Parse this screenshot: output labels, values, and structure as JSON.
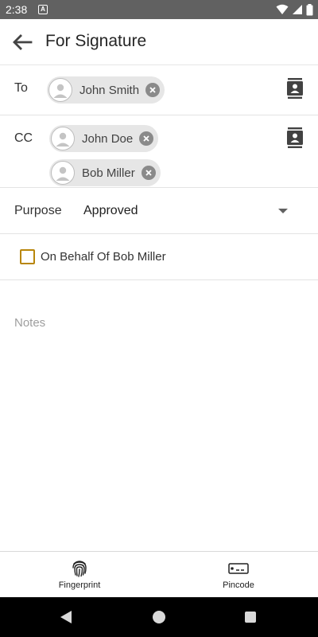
{
  "status_bar": {
    "time": "2:38",
    "notification_glyph": "A"
  },
  "header": {
    "title": "For Signature",
    "back_icon": "arrow-left-icon"
  },
  "to": {
    "label": "To",
    "recipients": [
      {
        "name": "John Smith"
      }
    ],
    "contacts_icon": "contacts-book-icon"
  },
  "cc": {
    "label": "CC",
    "recipients": [
      {
        "name": "John Doe"
      },
      {
        "name": "Bob Miller"
      }
    ],
    "contacts_icon": "contacts-book-icon"
  },
  "purpose": {
    "label": "Purpose",
    "selected": "Approved"
  },
  "on_behalf": {
    "label": "On Behalf Of Bob Miller",
    "checked": false
  },
  "notes": {
    "value": "",
    "placeholder": "Notes"
  },
  "bottom_actions": [
    {
      "label": "Fingerprint",
      "icon": "fingerprint-icon"
    },
    {
      "label": "Pincode",
      "icon": "pincode-icon"
    }
  ],
  "colors": {
    "checkbox_border": "#b8860b",
    "status_bar": "#616161",
    "chip_bg": "#e6e6e6"
  }
}
